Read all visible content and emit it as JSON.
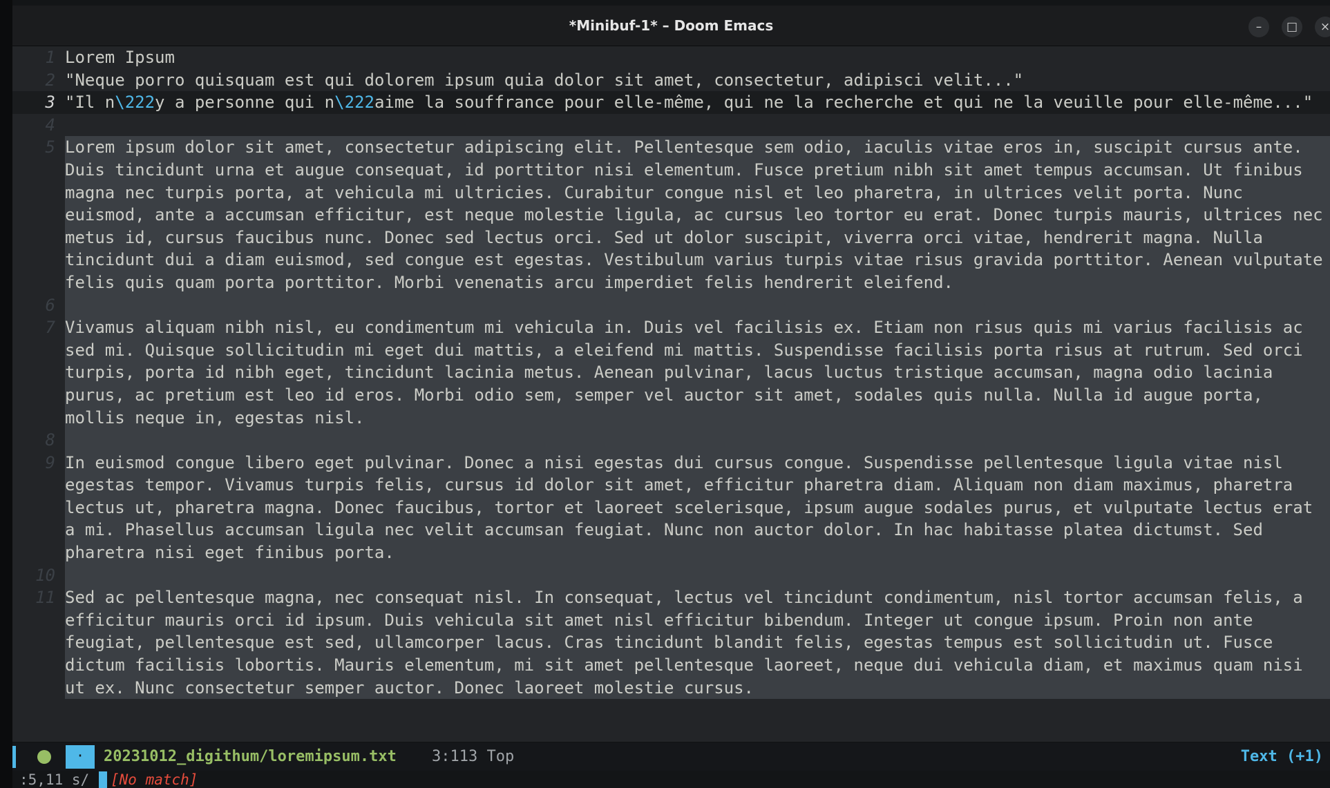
{
  "window": {
    "title": "*Minibuf-1* – Doom Emacs",
    "minimize_glyph": "–",
    "maximize_glyph": "□",
    "close_glyph": "×"
  },
  "lines": [
    {
      "num": "1",
      "text": "Lorem Ipsum"
    },
    {
      "num": "2",
      "text": "\"Neque porro quisquam est qui dolorem ipsum quia dolor sit amet, consectetur, adipisci velit...\""
    },
    {
      "num": "3",
      "seg1": "\"Il n",
      "esc1": "\\222",
      "seg2": "y a personne qui n",
      "esc2": "\\222",
      "seg3": "aime la souffrance pour elle-même, qui ne la recherche et qui ne la veuille pour elle-même...\""
    },
    {
      "num": "4",
      "text": ""
    },
    {
      "num": "5",
      "text": "Lorem ipsum dolor sit amet, consectetur adipiscing elit. Pellentesque sem odio, iaculis vitae eros in, suscipit cursus ante. Duis tincidunt urna et augue consequat, id porttitor nisi elementum. Fusce pretium nibh sit amet tempus accumsan. Ut finibus magna nec turpis porta, at vehicula mi ultricies. Curabitur congue nisl et leo pharetra, in ultrices velit porta. Nunc euismod, ante a accumsan efficitur, est neque molestie ligula, ac cursus leo tortor eu erat. Donec turpis mauris, ultrices nec metus id, cursus faucibus nunc. Donec sed lectus orci. Sed ut dolor suscipit, viverra orci vitae, hendrerit magna. Nulla tincidunt dui a diam euismod, sed congue est egestas. Vestibulum varius turpis vitae risus gravida porttitor. Aenean vulputate felis quis quam porta porttitor. Morbi venenatis arcu imperdiet felis hendrerit eleifend."
    },
    {
      "num": "6",
      "text": ""
    },
    {
      "num": "7",
      "text": "Vivamus aliquam nibh nisl, eu condimentum mi vehicula in. Duis vel facilisis ex. Etiam non risus quis mi varius facilisis ac sed mi. Quisque sollicitudin mi eget dui mattis, a eleifend mi mattis. Suspendisse facilisis porta risus at rutrum. Sed orci turpis, porta id nibh eget, tincidunt lacinia metus. Aenean pulvinar, lacus luctus tristique accumsan, magna odio lacinia purus, ac pretium est leo id eros. Morbi odio sem, semper vel auctor sit amet, sodales quis nulla. Nulla id augue porta, mollis neque in, egestas nisl."
    },
    {
      "num": "8",
      "text": ""
    },
    {
      "num": "9",
      "text": "In euismod congue libero eget pulvinar. Donec a nisi egestas dui cursus congue. Suspendisse pellentesque ligula vitae nisl egestas tempor. Vivamus turpis felis, cursus id dolor sit amet, efficitur pharetra diam. Aliquam non diam maximus, pharetra lectus ut, pharetra magna. Donec faucibus, tortor et laoreet scelerisque, ipsum augue sodales purus, et vulputate lectus erat a mi. Phasellus accumsan ligula nec velit accumsan feugiat. Nunc non auctor dolor. In hac habitasse platea dictumst. Sed pharetra nisi eget finibus porta."
    },
    {
      "num": "10",
      "text": ""
    },
    {
      "num": "11",
      "text": "Sed ac pellentesque magna, nec consequat nisl. In consequat, lectus vel tincidunt condimentum, nisl tortor accumsan felis, a efficitur mauris orci id ipsum. Duis vehicula sit amet nisl efficitur bibendum. Integer ut congue ipsum. Proin non ante feugiat, pellentesque est sed, ullamcorper lacus. Cras tincidunt blandit felis, egestas tempus est sollicitudin ut. Fusce dictum facilisis lobortis. Mauris elementum, mi sit amet pellentesque laoreet, neque dui vehicula diam, et maximus quam nisi ut ex. Nunc consectetur semper auctor. Donec laoreet molestie cursus."
    }
  ],
  "modeline": {
    "file_icon": "·",
    "file": "20231012_digithum/loremipsum.txt",
    "position": "3:113",
    "scroll": "Top",
    "mode": "Text (+1)"
  },
  "minibuffer": {
    "prompt": ":5,11 s/",
    "message": "[No match]"
  },
  "colors": {
    "background": "#232528",
    "selection": "#3b3f44",
    "accent": "#4fb8e8",
    "green": "#98be65",
    "error": "#e74c3c"
  }
}
